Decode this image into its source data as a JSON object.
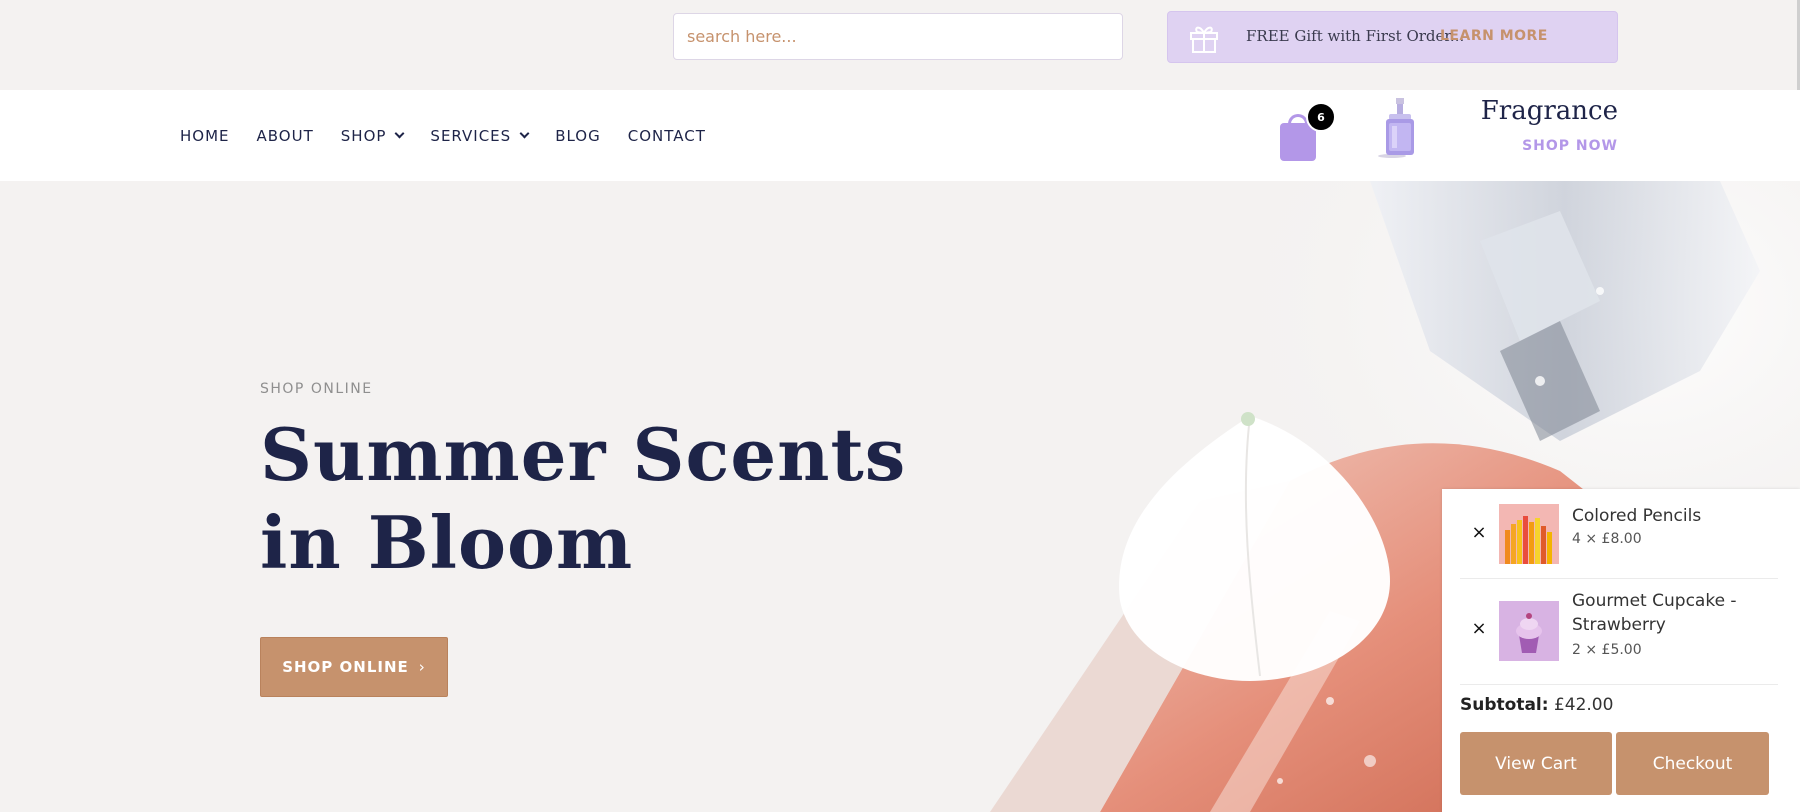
{
  "search": {
    "placeholder": "search here..."
  },
  "promo": {
    "text": "FREE Gift with First Order...",
    "link": "LEARN MORE",
    "icon": "gift-icon"
  },
  "nav": {
    "items": [
      {
        "label": "HOME",
        "dropdown": false
      },
      {
        "label": "ABOUT",
        "dropdown": false
      },
      {
        "label": "SHOP",
        "dropdown": true
      },
      {
        "label": "SERVICES",
        "dropdown": true
      },
      {
        "label": "BLOG",
        "dropdown": false
      },
      {
        "label": "CONTACT",
        "dropdown": false
      }
    ]
  },
  "cart": {
    "count": "6",
    "icon": "shopping-bag-icon"
  },
  "featured": {
    "title": "Fragrance",
    "link": "SHOP NOW"
  },
  "hero": {
    "eyebrow": "SHOP ONLINE",
    "title": "Summer Scents in Bloom",
    "button": "SHOP ONLINE",
    "button_arrow": "›"
  },
  "minicart": {
    "remove_glyph": "×",
    "items": [
      {
        "name": "Colored Pencils",
        "qty": "4 × £8.00"
      },
      {
        "name": "Gourmet Cupcake - Strawberry",
        "qty": "2 × £5.00"
      }
    ],
    "subtotal_label": "Subtotal:",
    "subtotal_value": "£42.00",
    "view_cart": "View Cart",
    "checkout": "Checkout"
  },
  "colors": {
    "accent": "#c6926d",
    "lavender": "#b397e8",
    "navy": "#1e2448",
    "background": "#f4f2f1"
  }
}
